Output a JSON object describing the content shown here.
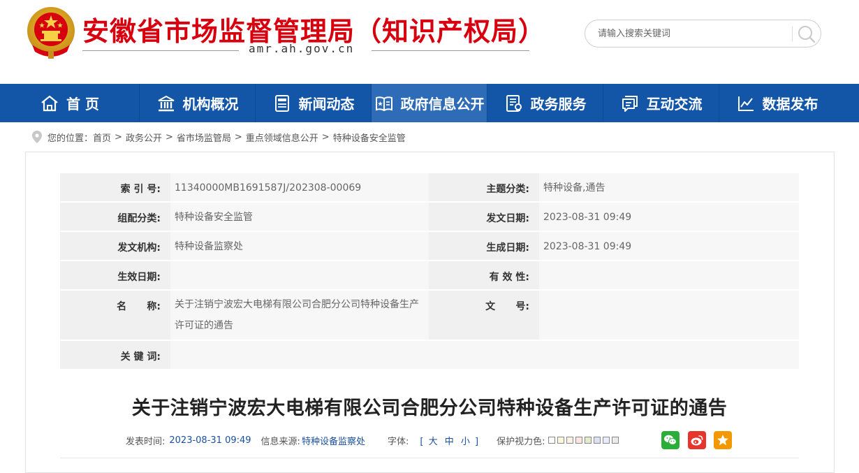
{
  "header": {
    "site_title": "安徽省市场监督管理局（知识产权局）",
    "domain": "amr.ah.gov.cn",
    "search": {
      "placeholder": "请输入搜索关键词"
    }
  },
  "nav": {
    "items": [
      {
        "label": "首 页",
        "icon": "home-icon"
      },
      {
        "label": "机构概况",
        "icon": "institution-icon"
      },
      {
        "label": "新闻动态",
        "icon": "news-icon"
      },
      {
        "label": "政府信息公开",
        "icon": "open-book-icon"
      },
      {
        "label": "政务服务",
        "icon": "service-icon"
      },
      {
        "label": "互动交流",
        "icon": "chat-icon"
      },
      {
        "label": "数据发布",
        "icon": "chart-icon"
      }
    ],
    "active_index": 3
  },
  "breadcrumb": {
    "prefix": "您的位置：",
    "items": [
      "首页",
      "政务公开",
      "省市场监管局",
      "重点领域信息公开",
      "特种设备安全监管"
    ],
    "separator": ">"
  },
  "info_table": {
    "index_label": "索 引 号:",
    "index_value": "11340000MB1691587J/202308-00069",
    "topic_label": "主题分类:",
    "topic_value": "特种设备,通告",
    "org_cat_label": "组配分类:",
    "org_cat_value": "特种设备安全监管",
    "issue_date_label": "发文日期:",
    "issue_date_value": "2023-08-31 09:49",
    "issuer_label": "发文机构:",
    "issuer_value": "特种设备监察处",
    "gen_date_label": "生成日期:",
    "gen_date_value": "2023-08-31 09:49",
    "effective_label": "生效日期:",
    "effective_value": "",
    "validity_label": "有 效 性:",
    "validity_value": "",
    "name_label": "名      称:",
    "name_value": "关于注销宁波宏大电梯有限公司合肥分公司特种设备生产许可证的通告",
    "docno_label": "文      号:",
    "docno_value": "",
    "keywords_label": "关 键 词:",
    "keywords_value": ""
  },
  "article": {
    "title": "关于注销宁波宏大电梯有限公司合肥分公司特种设备生产许可证的通告",
    "publish_label": "发表时间:",
    "publish_time": "2023-08-31 09:49",
    "source_label": "信息来源:",
    "source": "特种设备监察处",
    "font_label": "字体:",
    "font_open": "[",
    "font_large": "大",
    "font_medium": "中",
    "font_small": "小",
    "font_close": "]",
    "eye_label": "保护视力色:",
    "eye_colors": [
      "#ffffff",
      "#faf9de",
      "#fff2e2",
      "#fde6e0",
      "#e3edcd",
      "#dce2f1",
      "#e9ebfe",
      "#eaeaef"
    ]
  },
  "share": {
    "wechat": "wechat-icon",
    "weibo": "weibo-icon",
    "favorite": "star-icon",
    "colors": {
      "wechat": "#2aae39",
      "weibo": "#e6352c",
      "favorite": "#f39800"
    }
  },
  "colors": {
    "brand_red": "#d7000f",
    "nav_blue": "#1355a6",
    "nav_active": "#2f6cb8",
    "link_blue": "#1a4f9c"
  }
}
